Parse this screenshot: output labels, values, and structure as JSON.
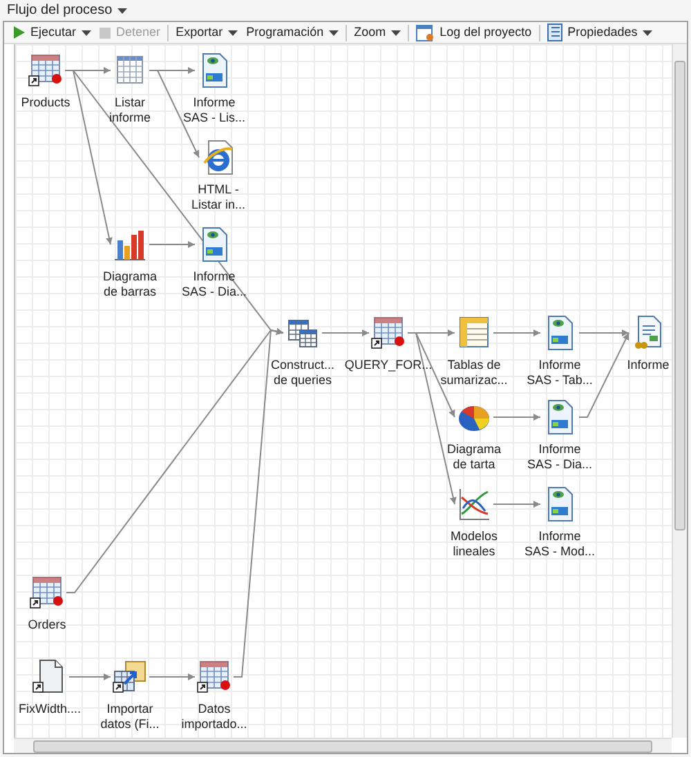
{
  "panel": {
    "title": "Flujo del proceso"
  },
  "toolbar": [
    {
      "kind": "play",
      "label": "Ejecutar",
      "dropdown": true,
      "disabled": false,
      "separator_after": false
    },
    {
      "kind": "stop",
      "label": "Detener",
      "dropdown": false,
      "disabled": true,
      "separator_after": true
    },
    {
      "kind": "text",
      "label": "Exportar",
      "dropdown": true,
      "disabled": false,
      "separator_after": false
    },
    {
      "kind": "text",
      "label": "Programación",
      "dropdown": true,
      "disabled": false,
      "separator_after": true
    },
    {
      "kind": "text",
      "label": "Zoom",
      "dropdown": true,
      "disabled": false,
      "separator_after": true
    },
    {
      "kind": "log",
      "label": "Log del proyecto",
      "dropdown": false,
      "disabled": false,
      "separator_after": true
    },
    {
      "kind": "properties",
      "label": "Propiedades",
      "dropdown": true,
      "disabled": false,
      "separator_after": false
    }
  ],
  "nodes": [
    {
      "kind": "dataset",
      "label": [
        "Products"
      ]
    },
    {
      "kind": "list",
      "label": [
        "Listar",
        "informe"
      ]
    },
    {
      "kind": "report",
      "label": [
        "Informe",
        "SAS - Lis..."
      ]
    },
    {
      "kind": "html",
      "label": [
        "HTML -",
        "Listar in..."
      ]
    },
    {
      "kind": "bar-chart",
      "label": [
        "Diagrama",
        "de barras"
      ]
    },
    {
      "kind": "report",
      "label": [
        "Informe",
        "SAS - Dia..."
      ]
    },
    {
      "kind": "query",
      "label": [
        "Construct...",
        "de queries"
      ]
    },
    {
      "kind": "dataset",
      "label": [
        "QUERY_FOR..."
      ]
    },
    {
      "kind": "summary",
      "label": [
        "Tablas de",
        "sumarizac..."
      ]
    },
    {
      "kind": "report",
      "label": [
        "Informe",
        "SAS - Tab..."
      ]
    },
    {
      "kind": "document",
      "label": [
        "Informe"
      ]
    },
    {
      "kind": "pie",
      "label": [
        "Diagrama",
        "de tarta"
      ]
    },
    {
      "kind": "report",
      "label": [
        "Informe",
        "SAS - Dia..."
      ]
    },
    {
      "kind": "line-model",
      "label": [
        "Modelos",
        "lineales"
      ]
    },
    {
      "kind": "report",
      "label": [
        "Informe",
        "SAS - Mod..."
      ]
    },
    {
      "kind": "dataset",
      "label": [
        "Orders"
      ]
    },
    {
      "kind": "text-file",
      "label": [
        "FixWidth...."
      ]
    },
    {
      "kind": "import",
      "label": [
        "Importar",
        "datos (Fi..."
      ]
    },
    {
      "kind": "dataset",
      "label": [
        "Datos",
        "importado..."
      ]
    }
  ]
}
